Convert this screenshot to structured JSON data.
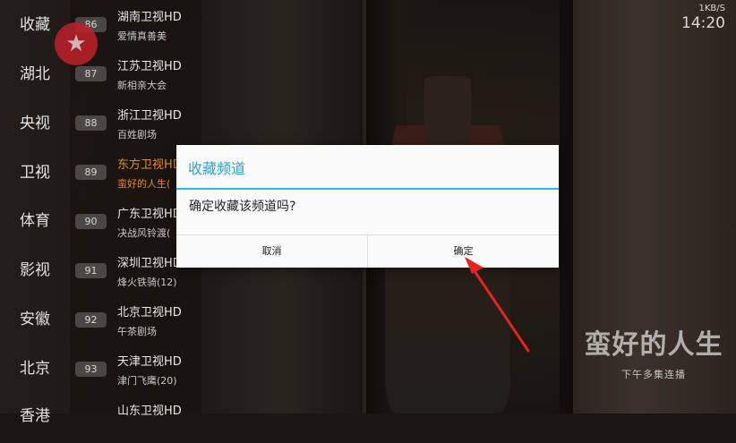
{
  "status": {
    "network_speed": "1KB/S",
    "time": "14:20"
  },
  "categories": [
    "收藏",
    "湖北",
    "央视",
    "卫视",
    "体育",
    "影视",
    "安徽",
    "北京",
    "香港"
  ],
  "channels": [
    {
      "number": "86",
      "name": "湖南卫视HD",
      "program": "爱情真善美"
    },
    {
      "number": "87",
      "name": "江苏卫视HD",
      "program": "新相亲大会"
    },
    {
      "number": "88",
      "name": "浙江卫视HD",
      "program": "百姓剧场"
    },
    {
      "number": "89",
      "name": "东方卫视HD",
      "program": "蛮好的人生("
    },
    {
      "number": "90",
      "name": "广东卫视HD",
      "program": "决战风铃渡("
    },
    {
      "number": "91",
      "name": "深圳卫视HD",
      "program": "烽火铁骑(12)"
    },
    {
      "number": "92",
      "name": "北京卫视HD",
      "program": "午茶剧场"
    },
    {
      "number": "93",
      "name": "天津卫视HD",
      "program": "津门飞鹰(20)"
    },
    {
      "number": "",
      "name": "山东卫视HD",
      "program": ""
    }
  ],
  "selected_channel_index": 3,
  "dialog": {
    "title": "收藏频道",
    "message": "确定收藏该频道吗?",
    "cancel_label": "取消",
    "ok_label": "确定"
  },
  "watermark": {
    "title": "蛮好的人生",
    "subtitle": "下午多集连播"
  },
  "colors": {
    "accent": "#33b5e5",
    "selected_text": "#e4892e",
    "logo": "#c0202a"
  },
  "icons": {
    "channel_logo": "star-logo-icon",
    "pointer": "red-arrow-icon"
  }
}
